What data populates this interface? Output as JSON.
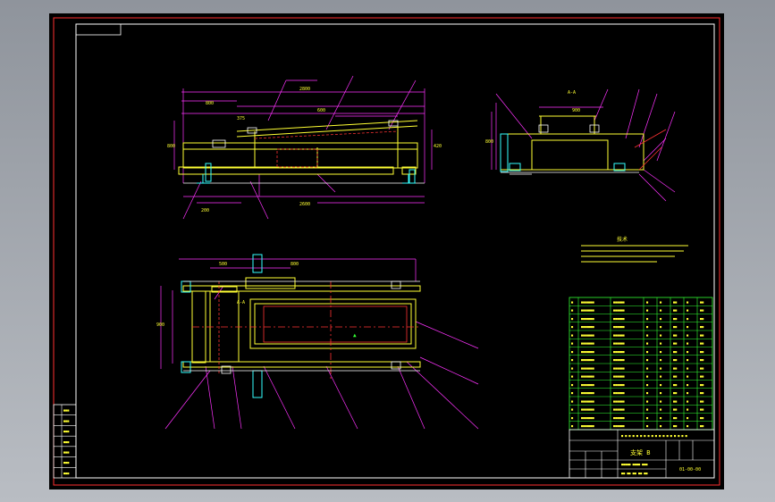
{
  "viewport": {
    "background": "#000000",
    "frame_color": "#ff3030"
  },
  "colors": {
    "yellow": "#ffff33",
    "magenta": "#ff33ff",
    "red": "#ff3333",
    "green": "#33ff33",
    "cyan": "#33ffff",
    "white": "#ffffff",
    "blue": "#3366ff"
  },
  "labels": {
    "notes_title": "技术",
    "title_block_main": "支架 B",
    "drawing_no": "01-00-00"
  },
  "left_table_rows": 7,
  "parts_table_rows": 16
}
